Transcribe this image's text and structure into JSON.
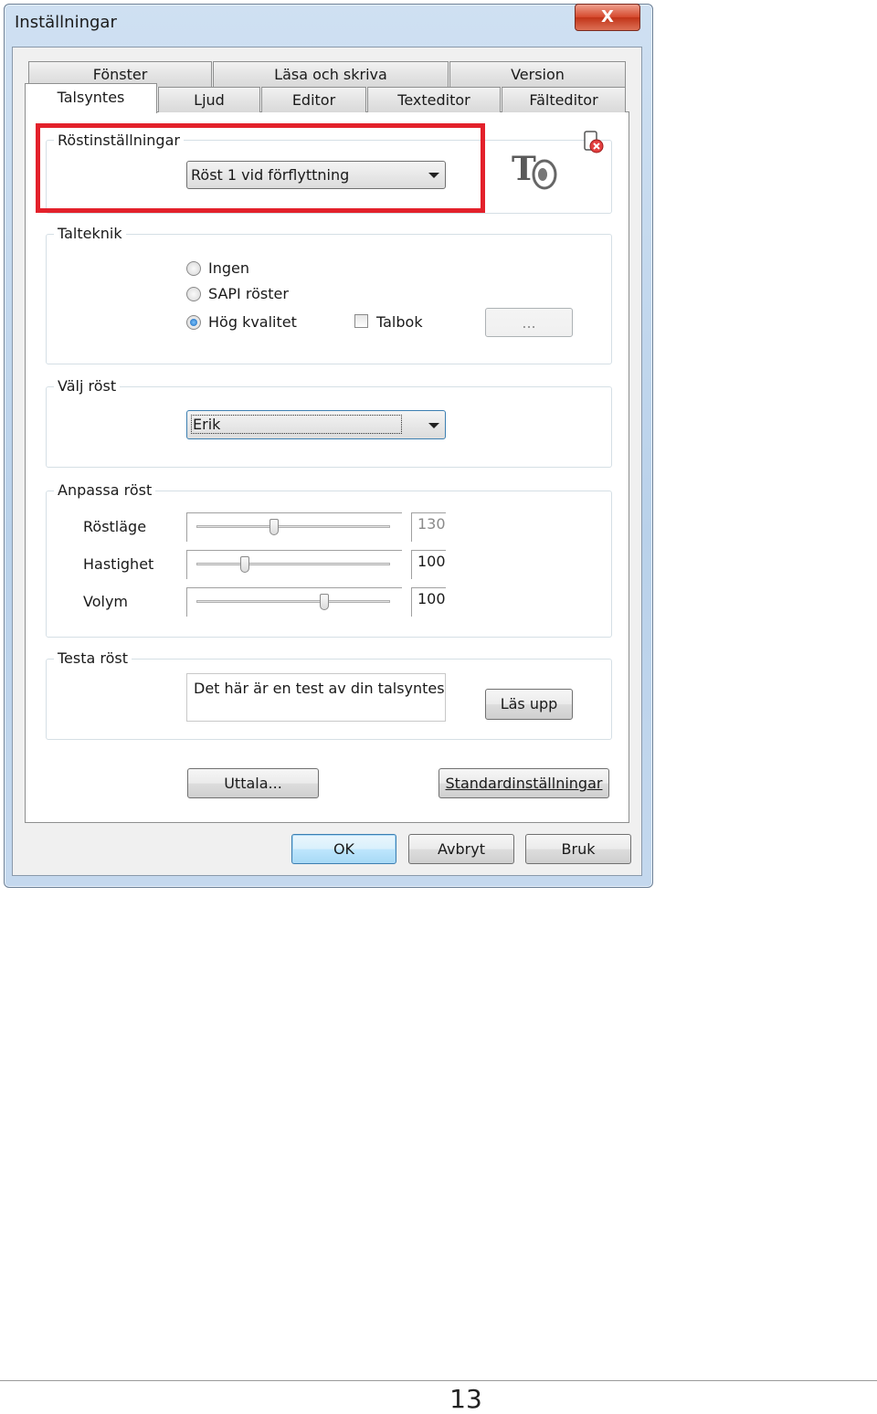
{
  "window": {
    "title": "Inställningar",
    "close_symbol": "X"
  },
  "tabs": {
    "row_back": [
      "Fönster",
      "Läsa och skriva",
      "Version"
    ],
    "row_front": [
      "Talsyntes",
      "Ljud",
      "Editor",
      "Texteditor",
      "Fälteditor"
    ],
    "active": "Talsyntes"
  },
  "rostinstallningar": {
    "label": "Röstinställningar",
    "selected": "Röst 1 vid förflyttning"
  },
  "logo": {
    "text": "T"
  },
  "talteknik": {
    "label": "Talteknik",
    "options": [
      "Ingen",
      "SAPI röster",
      "Hög kvalitet"
    ],
    "checked": "Hög kvalitet",
    "talbok_label": "Talbok",
    "browse_label": "..."
  },
  "valj_rost": {
    "label": "Välj röst",
    "selected": "Erik"
  },
  "anpassa_rost": {
    "label": "Anpassa röst",
    "rows": [
      {
        "label": "Röstläge",
        "value": "130",
        "level": 0.4
      },
      {
        "label": "Hastighet",
        "value": "100",
        "level": 0.25
      },
      {
        "label": "Volym",
        "value": "100",
        "level": 0.66
      }
    ]
  },
  "testa_rost": {
    "label": "Testa röst",
    "text": "Det här är en test av din talsyntes",
    "button": "Läs upp"
  },
  "actions": {
    "uttala": "Uttala...",
    "standard": "Standardinställningar"
  },
  "footer_buttons": {
    "ok": "OK",
    "cancel": "Avbryt",
    "apply": "Bruk"
  },
  "page": {
    "number": "13"
  },
  "colors": {
    "highlight": "#e3212b",
    "window_frame": "#b9d1ea"
  }
}
